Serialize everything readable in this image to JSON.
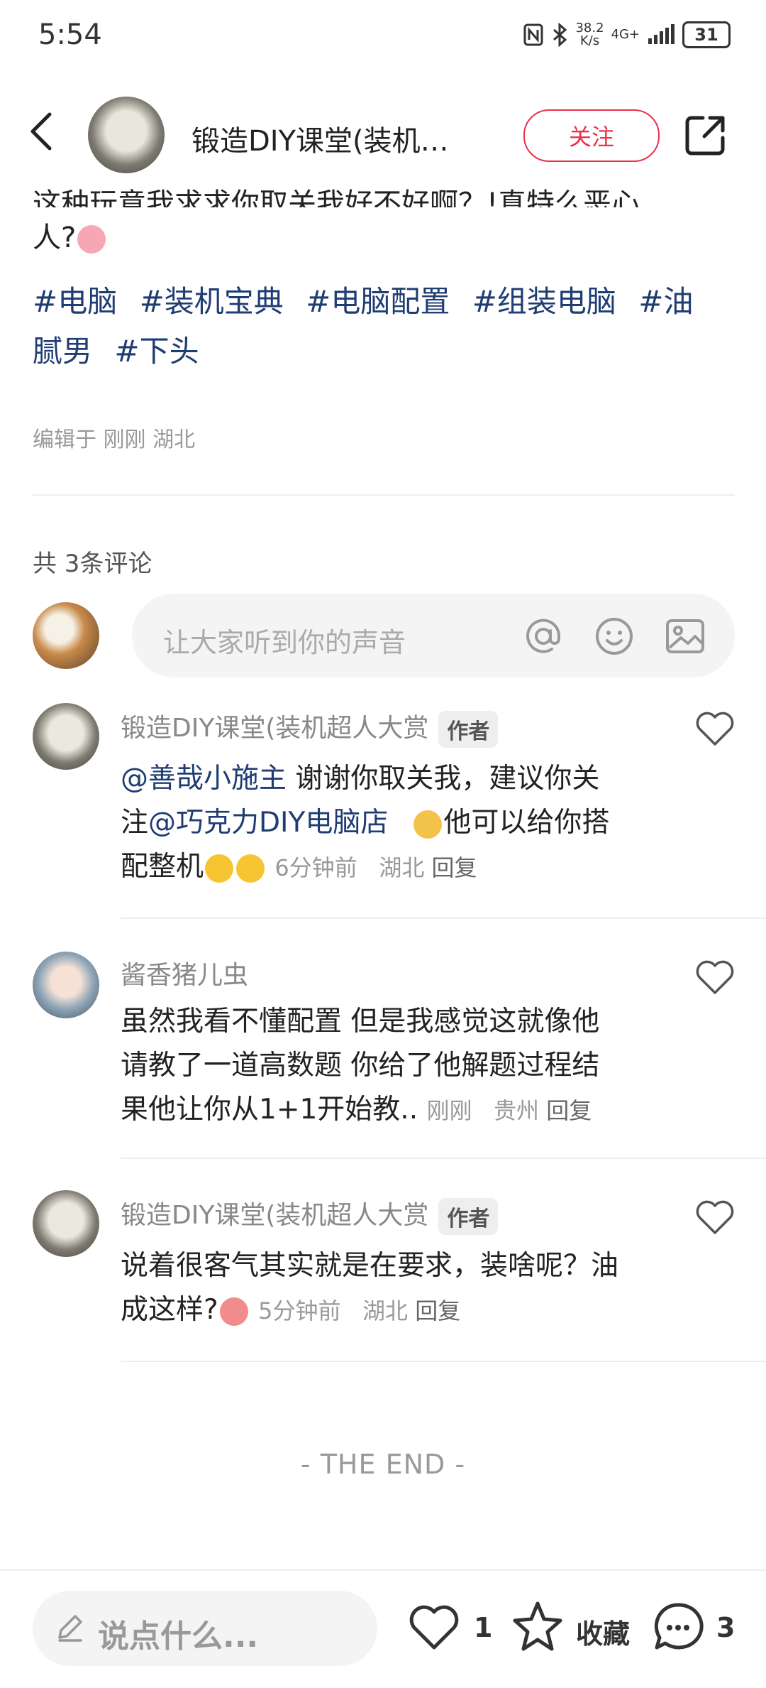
{
  "status_bar": {
    "time": "5:54",
    "net_speed_value": "38.2",
    "net_speed_unit": "K/s",
    "network": "4G+",
    "battery": "31"
  },
  "header": {
    "title": "锻造DIY课堂(装机…",
    "follow_label": "关注"
  },
  "post": {
    "text_cut": "这种玩意我求求你取关我好不好啊？!真特么恶心",
    "text_line2": "人?",
    "tags": [
      "#电脑",
      "#装机宝典",
      "#电脑配置",
      "#组装电脑",
      "#油",
      "腻男",
      "#下头"
    ],
    "edited": "编辑于 刚刚 湖北"
  },
  "comments_section": {
    "count_label": "共 3条评论",
    "input_placeholder": "让大家听到你的声音",
    "comments": [
      {
        "name": "锻造DIY课堂(装机超人大赏",
        "tag": "作者",
        "mention1": "@善哉小施主",
        "line1_rest": " 谢谢你取关我，建议你关",
        "line2_pre": "注",
        "mention2": "@巧克力DIY电脑店",
        "line2_rest": "他可以给你搭",
        "line3": "配整机",
        "time": "6分钟前",
        "location": "湖北",
        "reply": "回复"
      },
      {
        "name": "酱香猪儿虫",
        "line1": "虽然我看不懂配置 但是我感觉这就像他",
        "line2": "请教了一道高数题 你给了他解题过程结",
        "line3": "果他让你从1+1开始教..",
        "time": "刚刚",
        "location": "贵州",
        "reply": "回复"
      },
      {
        "name": "锻造DIY课堂(装机超人大赏",
        "tag": "作者",
        "line1": "说着很客气其实就是在要求，装啥呢？油",
        "line2": "成这样?",
        "time": "5分钟前",
        "location": "湖北",
        "reply": "回复"
      }
    ],
    "end_label": "- THE END -"
  },
  "bottom_bar": {
    "say_placeholder": "说点什么...",
    "likes": "1",
    "collect_label": "收藏",
    "comments": "3"
  },
  "colors": {
    "accent": "#e8324b",
    "link": "#1f3c73"
  }
}
